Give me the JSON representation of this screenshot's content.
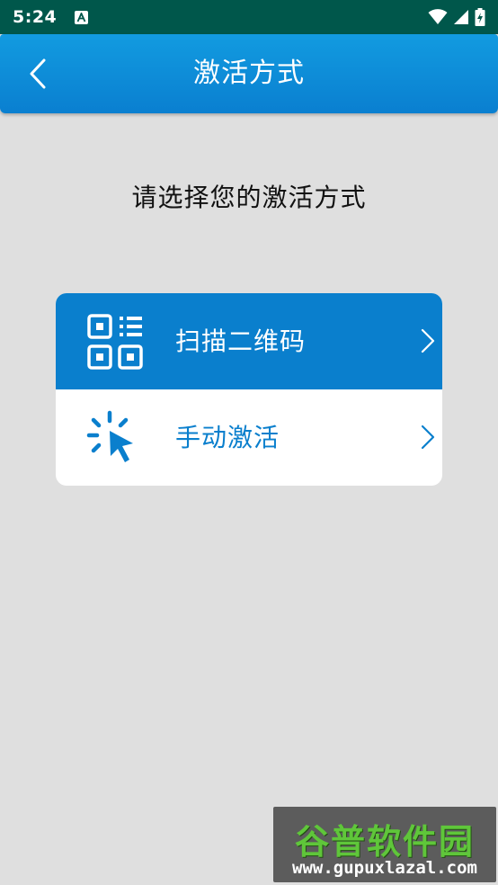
{
  "status_bar": {
    "time": "5:24",
    "icons": [
      "a-notification-icon",
      "wifi-icon",
      "signal-icon",
      "battery-charging-icon"
    ]
  },
  "app_bar": {
    "title": "激活方式",
    "back_icon": "chevron-left-icon"
  },
  "prompt": "请选择您的激活方式",
  "options": [
    {
      "label": "扫描二维码",
      "icon": "qr-code-icon",
      "selected": true
    },
    {
      "label": "手动激活",
      "icon": "click-cursor-icon",
      "selected": false
    }
  ],
  "colors": {
    "status_bar": "#00574b",
    "app_bar": "#0a7fd0",
    "accent": "#0a7fcd",
    "background": "#dfdfdf"
  },
  "watermark": {
    "brand": "谷普软件园",
    "url": "www.gupuxlazal.com"
  }
}
